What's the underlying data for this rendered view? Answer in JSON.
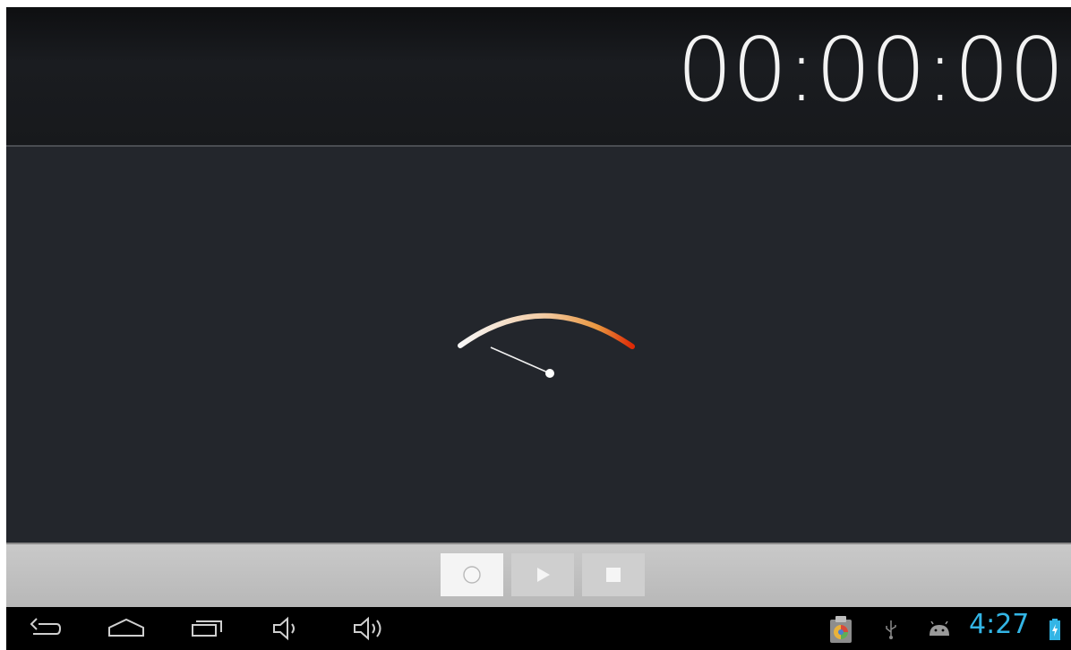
{
  "header": {
    "timer": "00:00:00"
  },
  "controls": {
    "record": {
      "icon": "record-icon"
    },
    "play": {
      "icon": "play-icon"
    },
    "stop": {
      "icon": "stop-icon"
    }
  },
  "navbar": {
    "buttons": [
      "back-icon",
      "home-icon",
      "recent-apps-icon",
      "volume-down-icon",
      "volume-up-icon"
    ]
  },
  "status_bar": {
    "clock": "4:27",
    "icons": [
      "app-notification-icon",
      "usb-icon",
      "android-debug-icon",
      "battery-charging-icon"
    ],
    "clock_color": "#33b5e5"
  },
  "colors": {
    "background": "#23262c",
    "header": "#121316",
    "control_bar": "#bdbdbd",
    "meter_start": "#f5f5f5",
    "meter_end": "#e53a0c"
  }
}
